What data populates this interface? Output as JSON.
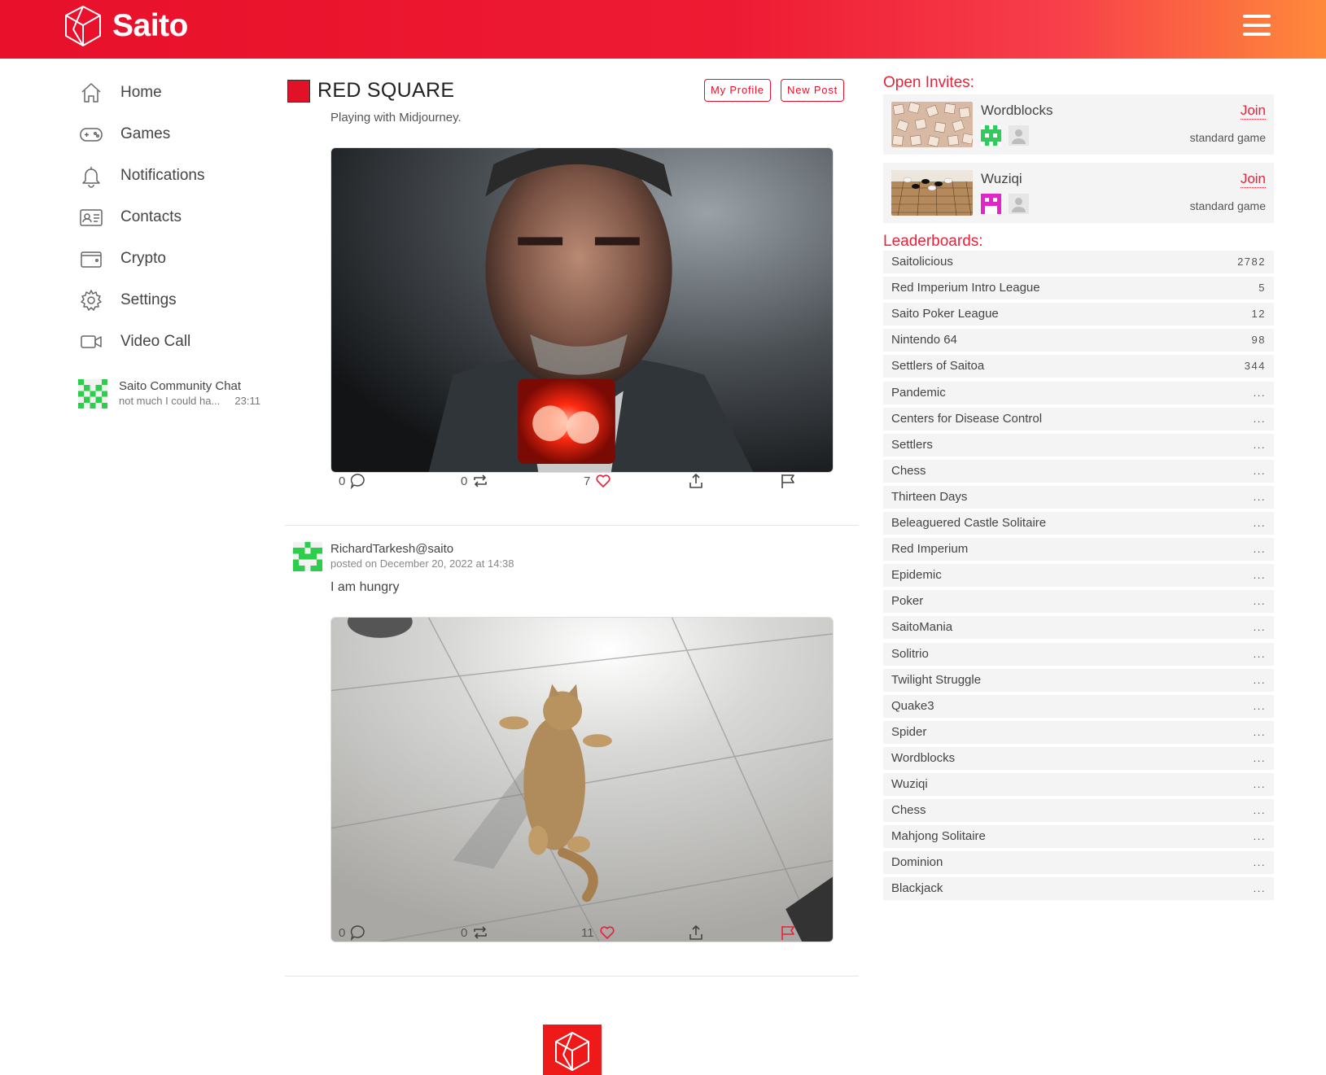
{
  "app": {
    "name": "Saito"
  },
  "nav": [
    {
      "label": "Home",
      "icon": "home-icon"
    },
    {
      "label": "Games",
      "icon": "gamepad-icon"
    },
    {
      "label": "Notifications",
      "icon": "bell-icon"
    },
    {
      "label": "Contacts",
      "icon": "contact-card-icon"
    },
    {
      "label": "Crypto",
      "icon": "wallet-icon"
    },
    {
      "label": "Settings",
      "icon": "gear-icon"
    },
    {
      "label": "Video Call",
      "icon": "video-camera-icon"
    }
  ],
  "chat": {
    "name": "Saito Community Chat",
    "last_message": "not much I could ha...",
    "time": "23:11"
  },
  "main": {
    "title": "RED SQUARE",
    "my_profile_label": "My Profile",
    "new_post_label": "New Post",
    "partial_text": "Playing with Midjourney.",
    "posts": [
      {
        "image": "midjourney-portrait",
        "comments": "0",
        "retweets": "0",
        "likes": "7",
        "flagged": false
      },
      {
        "author": "RichardTarkesh@saito",
        "date": "posted on December 20, 2022 at 14:38",
        "text": "I am hungry",
        "image": "cat-photo",
        "comments": "0",
        "retweets": "0",
        "likes": "11",
        "flagged": true
      }
    ]
  },
  "invites": {
    "title": "Open Invites:",
    "items": [
      {
        "game": "Wordblocks",
        "join": "Join",
        "type": "standard game",
        "avatar_color": "#2ecc5a"
      },
      {
        "game": "Wuziqi",
        "join": "Join",
        "type": "standard game",
        "avatar_color": "#e026c8"
      }
    ]
  },
  "leaderboards": {
    "title": "Leaderboards:",
    "items": [
      {
        "name": "Saitolicious",
        "value": "2782"
      },
      {
        "name": "Red Imperium Intro League",
        "value": "5"
      },
      {
        "name": "Saito Poker League",
        "value": "12"
      },
      {
        "name": "Nintendo 64",
        "value": "98"
      },
      {
        "name": "Settlers of Saitoa",
        "value": "344"
      },
      {
        "name": "Pandemic",
        "value": "..."
      },
      {
        "name": "Centers for Disease Control",
        "value": "..."
      },
      {
        "name": "Settlers",
        "value": "..."
      },
      {
        "name": "Chess",
        "value": "..."
      },
      {
        "name": "Thirteen Days",
        "value": "..."
      },
      {
        "name": "Beleaguered Castle Solitaire",
        "value": "..."
      },
      {
        "name": "Red Imperium",
        "value": "..."
      },
      {
        "name": "Epidemic",
        "value": "..."
      },
      {
        "name": "Poker",
        "value": "..."
      },
      {
        "name": "SaitoMania",
        "value": "..."
      },
      {
        "name": "Solitrio",
        "value": "..."
      },
      {
        "name": "Twilight Struggle",
        "value": "..."
      },
      {
        "name": "Quake3",
        "value": "..."
      },
      {
        "name": "Spider",
        "value": "..."
      },
      {
        "name": "Wordblocks",
        "value": "..."
      },
      {
        "name": "Wuziqi",
        "value": "..."
      },
      {
        "name": "Chess",
        "value": "..."
      },
      {
        "name": "Mahjong Solitaire",
        "value": "..."
      },
      {
        "name": "Dominion",
        "value": "..."
      },
      {
        "name": "Blackjack",
        "value": "..."
      }
    ]
  },
  "colors": {
    "brand_red": "#e8102a",
    "accent_orange": "#ff8a3a",
    "accent_pink": "#e8233a"
  }
}
